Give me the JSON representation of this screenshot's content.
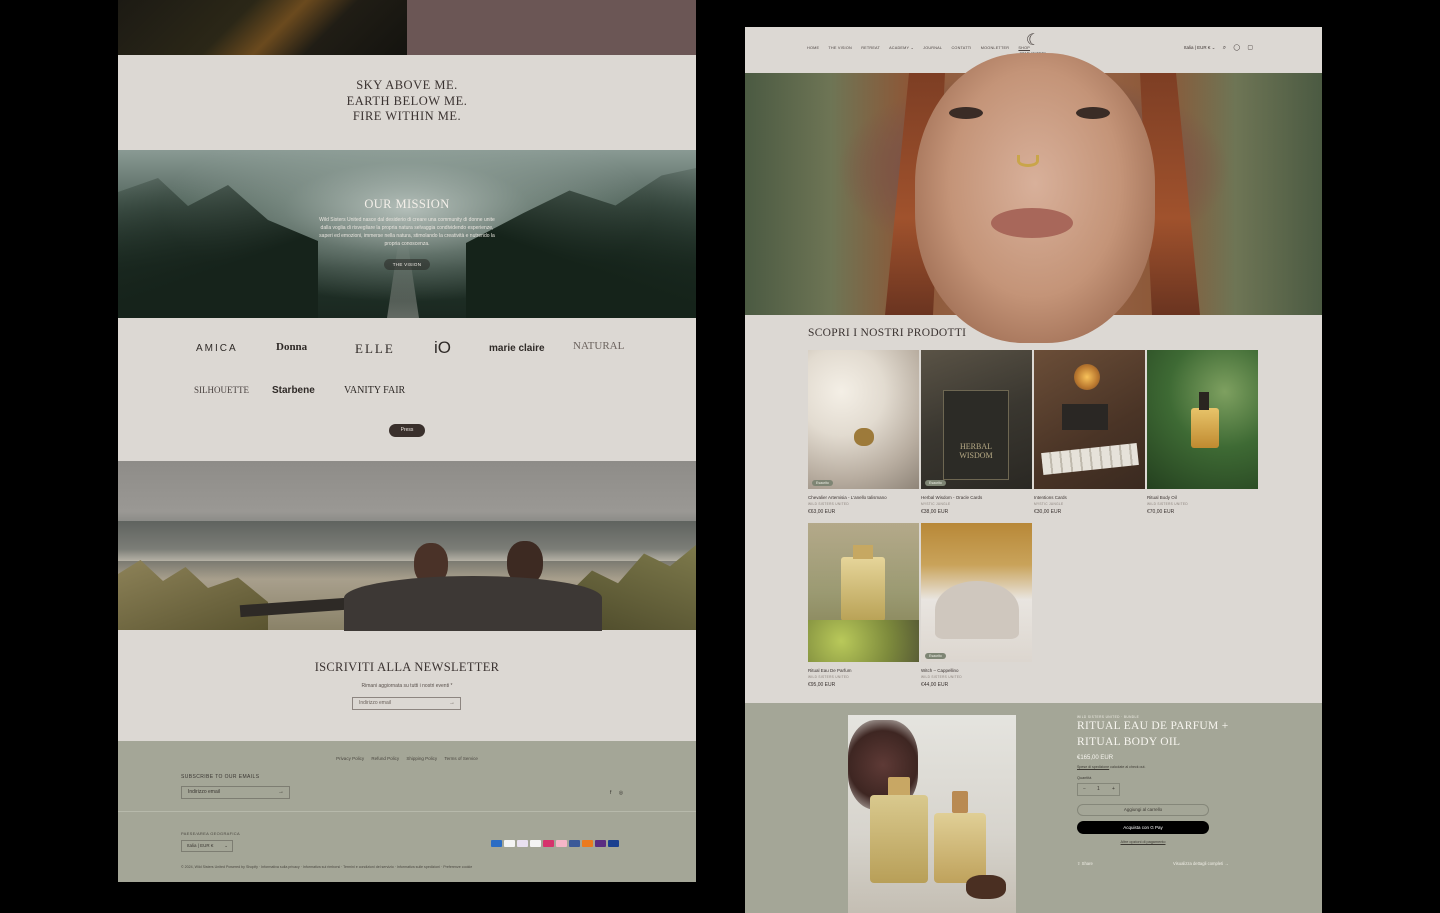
{
  "left": {
    "tagline": [
      "SKY ABOVE ME.",
      "EARTH BELOW ME.",
      "FIRE WITHIN ME."
    ],
    "mission": {
      "title": "OUR MISSION",
      "text": "Wild Sisters United nasce dal desiderio di creare una community di donne unite dalla voglia di risvegliare la propria natura selvaggia condividendo esperienze, saperi ed emozioni, immerse nella natura, stimolando la creatività e nutrendo la propria conoscenza.",
      "button": "THE VISION"
    },
    "press": {
      "logos": [
        "AMICA",
        "Donna",
        "ELLE",
        "iO",
        "marie claire",
        "NATURAL",
        "SILHOUETTE",
        "Starbene",
        "VANITY FAIR"
      ],
      "button": "Press"
    },
    "newsletter": {
      "title": "ISCRIVITI ALLA NEWSLETTER",
      "subtitle": "Rimani aggiornata su tutti i nostri eventi *",
      "placeholder": "Indirizzo email",
      "arrow": "→"
    },
    "footer": {
      "links": [
        "Privacy Policy",
        "Refund Policy",
        "Shipping Policy",
        "Terms of Service"
      ],
      "subscribe_title": "SUBSCRIBE TO OUR EMAILS",
      "email_placeholder": "Indirizzo email",
      "arrow": "→",
      "social": [
        "f",
        "◎"
      ],
      "country_label": "PAESE/AREA GEOGRAFICA",
      "country_value": "Italia | EUR €",
      "copyright": "© 2024, Wild Sisters United Powered by Shopify · Informativa sulla privacy · Informativa sui rimborsi · Termini e condizioni del servizio · Informativa sulle spedizioni · Preferenze cookie"
    }
  },
  "right": {
    "nav": [
      "HOME",
      "THE VISION",
      "RETREAT",
      "ACADEMY ⌄",
      "JOURNAL",
      "CONTATTI",
      "MOONLETTER",
      "SHOP"
    ],
    "brand": "WILD SISTERS UNITED",
    "brand_mark": "☾",
    "region": "Italia | EUR € ⌄",
    "header_icons": [
      "⌕",
      "◯",
      "▢"
    ],
    "products_title": "SCOPRI I NOSTRI PRODOTTI",
    "products": [
      {
        "title": "Chevalier Artemisia - L'anello talismano",
        "vendor": "WILD SISTERS UNITED",
        "price": "€63,00 EUR",
        "badge": "Esaurito"
      },
      {
        "title": "Herbal Wisdom - Oracle Cards",
        "vendor": "MYSTIC JUNGLE",
        "price": "€38,00 EUR",
        "badge": "Esaurito"
      },
      {
        "title": "Intentions Cards",
        "vendor": "MYSTIC JUNGLE",
        "price": "€30,00 EUR",
        "badge": ""
      },
      {
        "title": "Ritual Body Oil",
        "vendor": "WILD SISTERS UNITED",
        "price": "€70,00 EUR",
        "badge": ""
      },
      {
        "title": "Ritual Eau De Parfum",
        "vendor": "WILD SISTERS UNITED",
        "price": "€95,00 EUR",
        "badge": ""
      },
      {
        "title": "Witch – Cappellino",
        "vendor": "WILD SISTERS UNITED",
        "price": "€44,00 EUR",
        "badge": "Esaurito"
      }
    ],
    "featured": {
      "vendor": "WILD SISTERS UNITED · BUNDLE",
      "title": "RITUAL EAU DE PARFUM + RITUAL BODY OIL",
      "price": "€165,00 EUR",
      "shipping_link": "Spese di spedizione",
      "shipping_text": " calcolate al check out.",
      "qty_label": "Quantità",
      "qty_minus": "−",
      "qty_value": "1",
      "qty_plus": "+",
      "add_to_cart": "Aggiungi al carrello",
      "buy_now": "Acquista con G Pay",
      "more_payments": "Altre opzioni di pagamento",
      "share": "⇧ Share",
      "details": "Visualizza dettagli completi →"
    }
  }
}
